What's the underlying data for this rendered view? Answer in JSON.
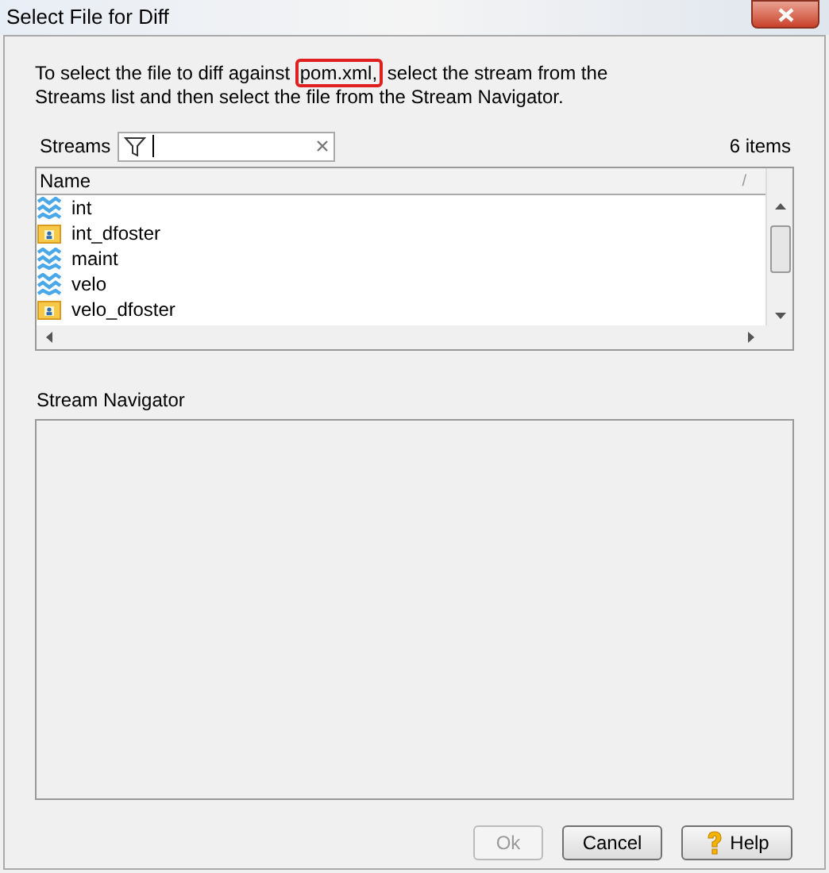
{
  "window": {
    "title": "Select File for Diff"
  },
  "instruction": {
    "before": "To select the file to diff against ",
    "highlight": "pom.xml,",
    "after": " select the stream from the Streams list and then select the file from the Stream Navigator."
  },
  "streams": {
    "label": "Streams",
    "count": "6 items",
    "column": "Name",
    "sort_mark": "/",
    "items": [
      {
        "kind": "stream",
        "name": "int"
      },
      {
        "kind": "workspace",
        "name": "int_dfoster"
      },
      {
        "kind": "stream",
        "name": "maint"
      },
      {
        "kind": "stream",
        "name": "velo"
      },
      {
        "kind": "workspace",
        "name": "velo_dfoster"
      }
    ]
  },
  "navigator": {
    "label": "Stream Navigator"
  },
  "buttons": [
    {
      "label": "Ok",
      "disabled": true,
      "icon": false
    },
    {
      "label": "Cancel",
      "disabled": false,
      "icon": false
    },
    {
      "label": "Help",
      "disabled": false,
      "icon": true
    }
  ]
}
